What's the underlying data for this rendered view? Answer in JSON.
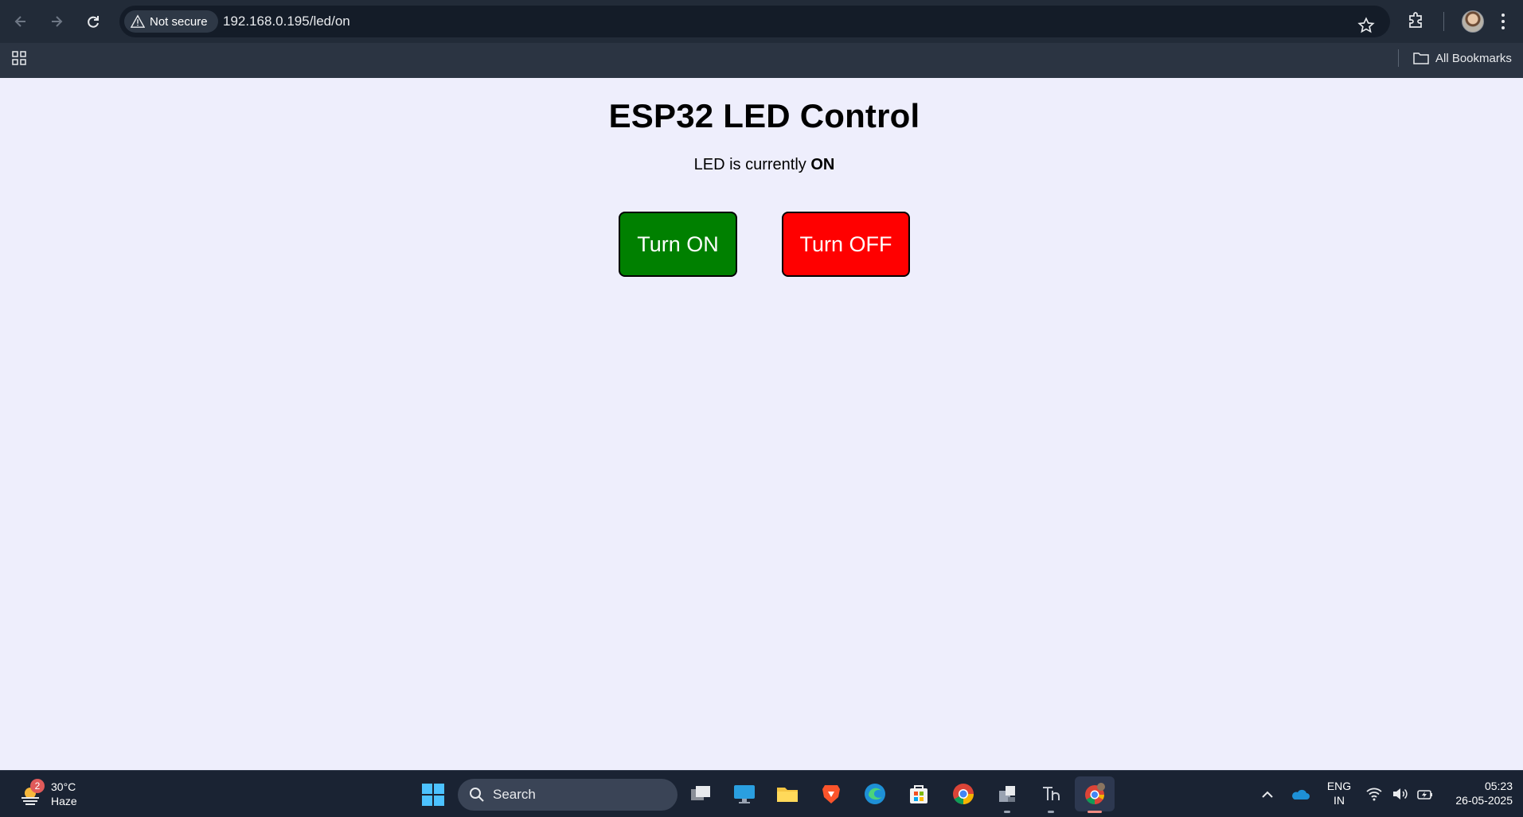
{
  "browser": {
    "security_label": "Not secure",
    "url": "192.168.0.195/led/on",
    "bookmarks_label": "All Bookmarks"
  },
  "page": {
    "title": "ESP32 LED Control",
    "status_prefix": "LED is currently ",
    "status_value": "ON",
    "on_button_label": "Turn ON",
    "off_button_label": "Turn OFF",
    "colors": {
      "background": "#EEEEFC",
      "on_button": "#008000",
      "off_button": "#FF0000"
    }
  },
  "taskbar": {
    "weather_badge": "2",
    "weather_temp": "30°C",
    "weather_desc": "Haze",
    "search_label": "Search",
    "apps": [
      "task-view-icon",
      "desktop-icon",
      "file-explorer-icon",
      "brave-icon",
      "edge-icon",
      "store-icon",
      "chrome-icon",
      "network-app-icon",
      "text-app-icon",
      "chrome-profile-icon"
    ],
    "lang_top": "ENG",
    "lang_bottom": "IN",
    "time": "05:23",
    "date": "26-05-2025"
  }
}
